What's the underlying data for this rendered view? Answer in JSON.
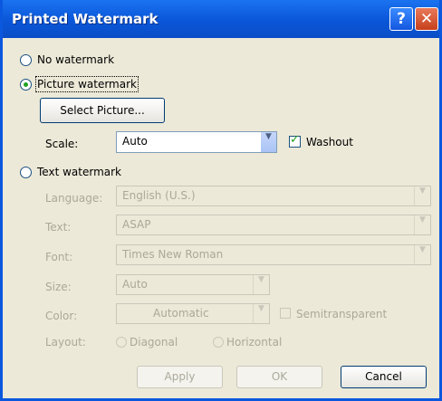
{
  "window": {
    "title": "Printed Watermark",
    "help_glyph": "?",
    "close_glyph": "✕"
  },
  "options": {
    "no_watermark": "No watermark",
    "picture_watermark": "Picture watermark",
    "text_watermark": "Text watermark",
    "selected": "picture_watermark"
  },
  "picture": {
    "select_button": "Select Picture...",
    "scale_label": "Scale:",
    "scale_value": "Auto",
    "washout_label": "Washout",
    "washout_checked": true
  },
  "text_section": {
    "language_label": "Language:",
    "language_value": "English (U.S.)",
    "text_label": "Text:",
    "text_value": "ASAP",
    "font_label": "Font:",
    "font_value": "Times New Roman",
    "size_label": "Size:",
    "size_value": "Auto",
    "color_label": "Color:",
    "color_value": "Automatic",
    "semitransparent_label": "Semitransparent",
    "layout_label": "Layout:",
    "diagonal_label": "Diagonal",
    "horizontal_label": "Horizontal"
  },
  "buttons": {
    "apply": "Apply",
    "ok": "OK",
    "cancel": "Cancel"
  },
  "colors": {
    "titlebar": "#0a56d8",
    "dialog_bg": "#ece9d8",
    "radio_selected": "#21a121"
  }
}
